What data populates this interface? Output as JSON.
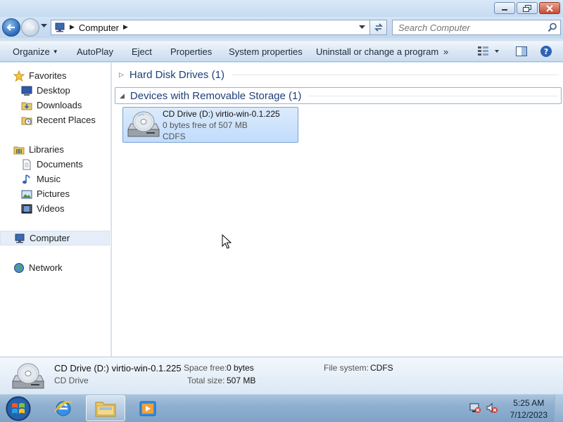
{
  "window": {
    "controls": [
      "minimize-icon",
      "maximize-icon",
      "close-icon"
    ]
  },
  "address": {
    "path": [
      "Computer"
    ],
    "search_placeholder": "Search Computer"
  },
  "toolbar": {
    "organize": "Organize",
    "autoplay": "AutoPlay",
    "eject": "Eject",
    "properties": "Properties",
    "system_properties": "System properties",
    "uninstall": "Uninstall or change a program",
    "more": "»"
  },
  "nav": {
    "favorites": "Favorites",
    "desktop": "Desktop",
    "downloads": "Downloads",
    "recent_places": "Recent Places",
    "libraries": "Libraries",
    "documents": "Documents",
    "music": "Music",
    "pictures": "Pictures",
    "videos": "Videos",
    "computer": "Computer",
    "network": "Network"
  },
  "groups": [
    {
      "title": "Hard Disk Drives (1)",
      "expanded": false
    },
    {
      "title": "Devices with Removable Storage (1)",
      "expanded": true
    }
  ],
  "drive": {
    "name": "CD Drive (D:) virtio-win-0.1.225",
    "free": "0 bytes free of 507 MB",
    "fs": "CDFS",
    "capacity_used_fraction": 1.0
  },
  "details": {
    "name": "CD Drive (D:) virtio-win-0.1.225",
    "type": "CD Drive",
    "space_free_label": "Space free:",
    "space_free_value": "0 bytes",
    "total_size_label": "Total size:",
    "total_size_value": "507 MB",
    "fs_label": "File system:",
    "fs_value": "CDFS"
  },
  "taskbar": {
    "time": "5:25 AM",
    "date": "7/12/2023"
  },
  "colors": {
    "accent": "#1e3f7a",
    "selection": "#c1dcfc"
  }
}
